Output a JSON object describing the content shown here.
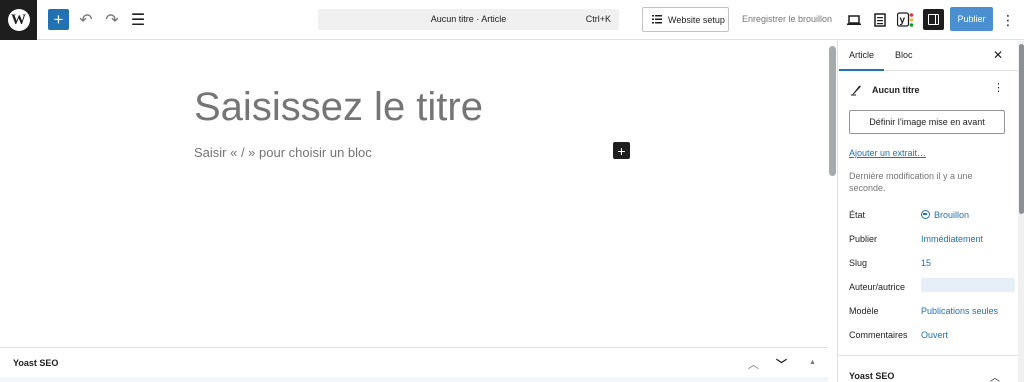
{
  "topbar": {
    "logo_letter": "W",
    "add_symbol": "+",
    "undo_icon": "↶",
    "redo_icon": "↷",
    "list_view_icon": "☰",
    "command_title": "Aucun titre · Article",
    "command_shortcut": "Ctrl+K",
    "website_setup_label": "Website setup",
    "save_draft_label": "Enregistrer le brouillon",
    "publish_label": "Publier",
    "more_icon": "⋮"
  },
  "editor": {
    "title_placeholder": "Saisissez le titre",
    "block_placeholder": "Saisir « / » pour choisir un bloc",
    "inline_add_symbol": "+"
  },
  "meta_box": {
    "label": "Yoast SEO",
    "up_icon": "︿",
    "down_icon": "﹀",
    "collapse_icon": "▲"
  },
  "sidebar": {
    "tabs": [
      {
        "label": "Article"
      },
      {
        "label": "Bloc"
      }
    ],
    "close_icon": "✕",
    "doc_title": "Aucun titre",
    "doc_more_icon": "⋮",
    "featured_image_label": "Définir l’image mise en avant",
    "excerpt_link": "Ajouter un extrait…",
    "last_modified": "Dernière modification il y a une seconde.",
    "rows": [
      {
        "key": "État",
        "value": "Brouillon"
      },
      {
        "key": "Publier",
        "value": "Immédiatement"
      },
      {
        "key": "Slug",
        "value": "15"
      },
      {
        "key": "Auteur/autrice",
        "value": ""
      },
      {
        "key": "Modèle",
        "value": "Publications seules"
      },
      {
        "key": "Commentaires",
        "value": "Ouvert"
      }
    ],
    "yoast_label": "Yoast SEO",
    "yoast_chevron": "︿"
  },
  "colors": {
    "accent": "#2271b1",
    "publish": "#4a90d0",
    "dark": "#1e1e1e"
  }
}
